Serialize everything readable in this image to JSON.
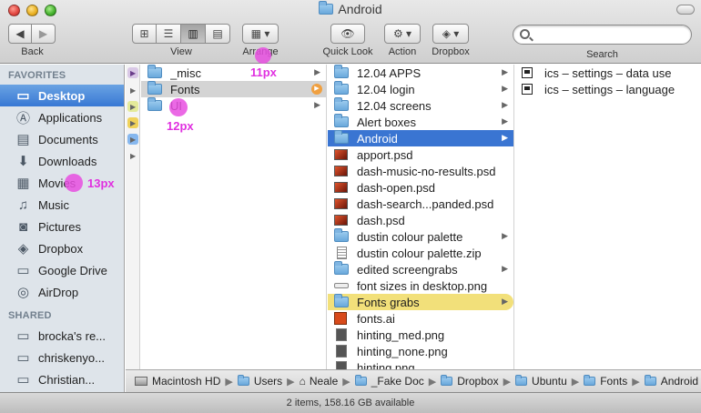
{
  "window": {
    "title": "Android"
  },
  "toolbar": {
    "back": {
      "label": "Back"
    },
    "view": {
      "label": "View"
    },
    "arrange": {
      "label": "Arrange"
    },
    "quick_look": {
      "label": "Quick Look"
    },
    "action": {
      "label": "Action"
    },
    "dropbox": {
      "label": "Dropbox"
    },
    "search": {
      "label": "Search",
      "value": "",
      "placeholder": ""
    }
  },
  "sidebar": {
    "favorites_heading": "FAVORITES",
    "favorites": [
      {
        "label": "Desktop",
        "icon": "desktop-icon",
        "selected": true
      },
      {
        "label": "Applications",
        "icon": "applications-icon"
      },
      {
        "label": "Documents",
        "icon": "documents-icon"
      },
      {
        "label": "Downloads",
        "icon": "downloads-icon"
      },
      {
        "label": "Movies",
        "icon": "movies-icon"
      },
      {
        "label": "Music",
        "icon": "music-icon"
      },
      {
        "label": "Pictures",
        "icon": "pictures-icon"
      },
      {
        "label": "Dropbox",
        "icon": "dropbox-icon"
      },
      {
        "label": "Google Drive",
        "icon": "google-drive-icon"
      },
      {
        "label": "AirDrop",
        "icon": "airdrop-icon"
      }
    ],
    "shared_heading": "SHARED",
    "shared": [
      {
        "label": "brocka's re...",
        "icon": "computer-icon"
      },
      {
        "label": "chriskenyo...",
        "icon": "computer-icon"
      },
      {
        "label": "Christian...",
        "icon": "computer-icon"
      }
    ]
  },
  "columns": {
    "col1": [
      {
        "name": "_misc",
        "icon": "folder-icon",
        "has_children": true
      },
      {
        "name": "Fonts",
        "icon": "folder-alias-icon",
        "has_children": true,
        "highlight": "gray"
      },
      {
        "name": "UI",
        "icon": "folder-icon",
        "has_children": true
      }
    ],
    "col2": [
      {
        "name": "12.04 APPS",
        "icon": "folder-icon",
        "has_children": true
      },
      {
        "name": "12.04 login",
        "icon": "folder-icon",
        "has_children": true
      },
      {
        "name": "12.04 screens",
        "icon": "folder-icon",
        "has_children": true
      },
      {
        "name": "Alert boxes",
        "icon": "folder-icon",
        "has_children": true
      },
      {
        "name": "Android",
        "icon": "folder-icon",
        "has_children": true,
        "selected": true
      },
      {
        "name": "apport.psd",
        "icon": "psd-icon"
      },
      {
        "name": "dash-music-no-results.psd",
        "icon": "psd-icon"
      },
      {
        "name": "dash-open.psd",
        "icon": "psd-icon"
      },
      {
        "name": "dash-search...panded.psd",
        "icon": "psd-icon"
      },
      {
        "name": "dash.psd",
        "icon": "psd-icon"
      },
      {
        "name": "dustin colour palette",
        "icon": "folder-icon",
        "has_children": true
      },
      {
        "name": "dustin colour palette.zip",
        "icon": "zip-icon"
      },
      {
        "name": "edited screengrabs",
        "icon": "folder-icon",
        "has_children": true
      },
      {
        "name": "font sizes in desktop.png",
        "icon": "png-icon"
      },
      {
        "name": "Fonts grabs",
        "icon": "folder-icon",
        "has_children": true,
        "highlight": "yellow"
      },
      {
        "name": "fonts.ai",
        "icon": "ai-icon"
      },
      {
        "name": "hinting_med.png",
        "icon": "png-icon"
      },
      {
        "name": "hinting_none.png",
        "icon": "png-icon"
      },
      {
        "name": "hinting.png",
        "icon": "png-icon"
      }
    ],
    "col3": [
      {
        "name": "ics – settings – data use",
        "icon": "document-icon"
      },
      {
        "name": "ics – settings – language",
        "icon": "document-icon"
      }
    ]
  },
  "pathbar": [
    {
      "label": "Macintosh HD",
      "icon": "hard-drive-icon"
    },
    {
      "label": "Users",
      "icon": "folder-icon"
    },
    {
      "label": "Neale",
      "icon": "home-icon"
    },
    {
      "label": "_Fake Doc",
      "icon": "folder-icon"
    },
    {
      "label": "Dropbox",
      "icon": "dropbox-folder-icon"
    },
    {
      "label": "Ubuntu",
      "icon": "folder-icon"
    },
    {
      "label": "Fonts",
      "icon": "folder-icon"
    },
    {
      "label": "Android",
      "icon": "folder-icon"
    }
  ],
  "status": "2 items, 158.16 GB available",
  "annotations": [
    {
      "text": "11px"
    },
    {
      "text": "12px"
    },
    {
      "text": "13px"
    }
  ],
  "colors": {
    "selection": "#3a75d2",
    "sidebar_bg": "#dee4ea",
    "annotation": "#e030e0",
    "label_yellow": "#f2e07a"
  }
}
